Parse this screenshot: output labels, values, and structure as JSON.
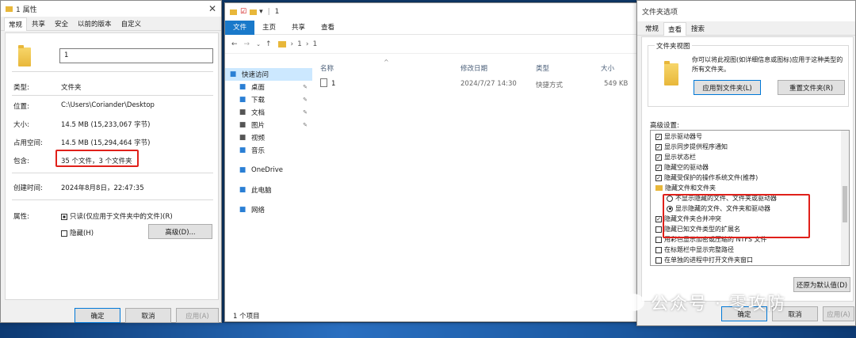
{
  "props": {
    "title": "1 属性",
    "tabs": [
      "常规",
      "共享",
      "安全",
      "以前的版本",
      "自定义"
    ],
    "name_value": "1",
    "type_label": "类型:",
    "type_value": "文件夹",
    "location_label": "位置:",
    "location_value": "C:\\Users\\Coriander\\Desktop",
    "size_label": "大小:",
    "size_value": "14.5 MB (15,233,067 字节)",
    "disk_label": "占用空间:",
    "disk_value": "14.5 MB (15,294,464 字节)",
    "contains_label": "包含:",
    "contains_value": "35 个文件，3 个文件夹",
    "created_label": "创建时间:",
    "created_value": "2024年8月8日，22:47:35",
    "attr_label": "属性:",
    "readonly_label": "只读(仅应用于文件夹中的文件)(R)",
    "hidden_label": "隐藏(H)",
    "advanced_label": "高级(D)...",
    "ok": "确定",
    "cancel": "取消",
    "apply": "应用(A)"
  },
  "explorer": {
    "title": "1",
    "ribbon_tabs": [
      "文件",
      "主页",
      "共享",
      "查看"
    ],
    "breadcrumb": [
      "1",
      "1"
    ],
    "nav": [
      {
        "label": "快速访问",
        "icon": "star-icon",
        "color": "#2a7fd4"
      },
      {
        "label": "桌面",
        "icon": "desktop-icon",
        "color": "#2a7fd4",
        "pin": true
      },
      {
        "label": "下载",
        "icon": "download-icon",
        "color": "#2a7fd4",
        "pin": true
      },
      {
        "label": "文档",
        "icon": "document-icon",
        "color": "#555",
        "pin": true
      },
      {
        "label": "图片",
        "icon": "picture-icon",
        "color": "#555",
        "pin": true
      },
      {
        "label": "视频",
        "icon": "video-icon",
        "color": "#555"
      },
      {
        "label": "音乐",
        "icon": "music-icon",
        "color": "#2a7fd4"
      },
      {
        "label": "OneDrive",
        "icon": "cloud-icon",
        "color": "#2a7fd4"
      },
      {
        "label": "此电脑",
        "icon": "computer-icon",
        "color": "#2a7fd4"
      },
      {
        "label": "网络",
        "icon": "network-icon",
        "color": "#2a7fd4"
      }
    ],
    "columns": [
      "名称",
      "修改日期",
      "类型",
      "大小"
    ],
    "file": {
      "name": "1",
      "date": "2024/7/27 14:30",
      "type": "快捷方式",
      "size": "549 KB"
    },
    "status": "1 个项目"
  },
  "options": {
    "title": "文件夹选项",
    "tabs": [
      "常规",
      "查看",
      "搜索"
    ],
    "group_title": "文件夹视图",
    "desc": "你可以将此视图(如详细信息或图标)应用于这种类型的所有文件夹。",
    "apply_folders": "应用到文件夹(L)",
    "reset_folders": "重置文件夹(R)",
    "advanced_label": "高级设置:",
    "items": [
      {
        "kind": "check",
        "checked": true,
        "label": "显示驱动器号"
      },
      {
        "kind": "check",
        "checked": true,
        "label": "显示同步提供程序通知"
      },
      {
        "kind": "check",
        "checked": true,
        "label": "显示状态栏"
      },
      {
        "kind": "check",
        "checked": true,
        "label": "隐藏空的驱动器"
      },
      {
        "kind": "check",
        "checked": true,
        "label": "隐藏受保护的操作系统文件(推荐)"
      },
      {
        "kind": "folder",
        "label": "隐藏文件和文件夹"
      },
      {
        "kind": "radio",
        "checked": false,
        "label": "不显示隐藏的文件、文件夹或驱动器"
      },
      {
        "kind": "radio",
        "checked": true,
        "label": "显示隐藏的文件、文件夹和驱动器"
      },
      {
        "kind": "check",
        "checked": true,
        "label": "隐藏文件夹合并冲突"
      },
      {
        "kind": "check",
        "checked": false,
        "label": "隐藏已知文件类型的扩展名"
      },
      {
        "kind": "check",
        "checked": false,
        "label": "用彩色显示加密或压缩的 NTFS 文件"
      },
      {
        "kind": "check",
        "checked": false,
        "label": "在标题栏中显示完整路径"
      },
      {
        "kind": "check",
        "checked": false,
        "label": "在单独的进程中打开文件夹窗口"
      }
    ],
    "restore": "还原为默认值(D)",
    "ok": "确定",
    "cancel": "取消",
    "apply": "应用(A)"
  },
  "watermark": "公众号 · 零攻防"
}
